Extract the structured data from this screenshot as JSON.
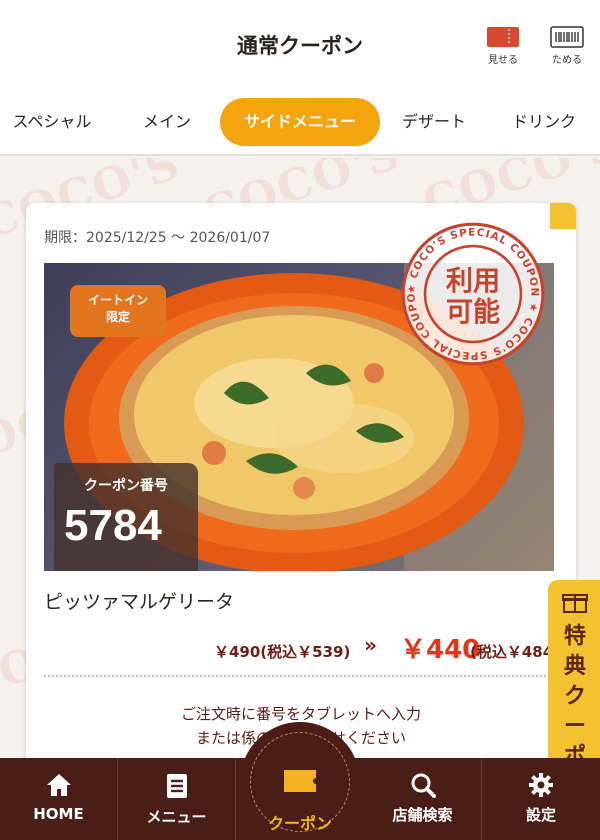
{
  "header": {
    "title": "通常クーポン",
    "show_label": "見せる",
    "save_label": "ためる"
  },
  "tabs": [
    {
      "label": "スペシャル"
    },
    {
      "label": "メイン"
    },
    {
      "label": "サイドメニュー",
      "active": true
    },
    {
      "label": "デザート"
    },
    {
      "label": "ドリンク"
    }
  ],
  "background_text": "COCO'S",
  "coupon": {
    "period": "期限：2025/12/25 〜 2026/01/07",
    "eatin_line1": "イートイン",
    "eatin_line2": "限定",
    "number_label": "クーポン番号",
    "number": "5784",
    "stamp": {
      "line1": "利用",
      "line2": "可能",
      "ring_text": "★ COCO'S SPECIAL COUPON ★ COCO'S SPECIAL COUPON"
    },
    "item_name": "ピッツァマルゲリータ",
    "price_old": "￥490(税込￥539)",
    "arrow": "»",
    "price_new": "￥440",
    "price_new_tax": "(税込￥484)",
    "note_line1": "ご注文時に番号をタブレットへ入力",
    "note_line2": "または係の者にお見せください"
  },
  "side_tab": {
    "label": "特典クーポ"
  },
  "nav": {
    "home": "HOME",
    "menu": "メニュー",
    "coupon": "クーポン",
    "store": "店舗検索",
    "settings": "設定"
  },
  "colors": {
    "accent": "#f4a50e",
    "nav_bg": "#4a1d16",
    "price_red": "#e2351a",
    "stamp_red": "#c8432e"
  }
}
